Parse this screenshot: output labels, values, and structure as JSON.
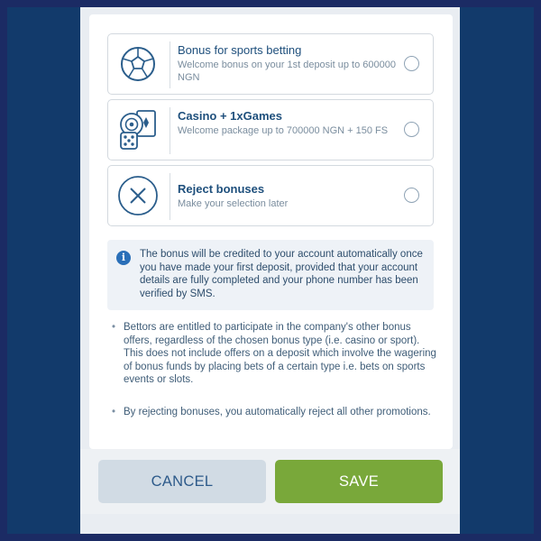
{
  "options": [
    {
      "title": "Bonus for sports betting",
      "desc": "Welcome bonus on your 1st deposit up to 600000 NGN",
      "icon": "soccer-ball-icon",
      "selected": false
    },
    {
      "title": "Casino + 1xGames",
      "desc": "Welcome package up to 700000 NGN + 150 FS",
      "icon": "casino-chips-cards-icon",
      "selected": false
    },
    {
      "title": "Reject bonuses",
      "desc": "Make your selection later",
      "icon": "close-circle-icon",
      "selected": false
    }
  ],
  "info": {
    "icon": "info-icon",
    "glyph": "i",
    "text": "The bonus will be credited to your account automatically once you have made your first deposit, provided that your account details are fully completed and your phone number has been verified by SMS."
  },
  "bullets": [
    "Bettors are entitled to participate in the company's other bonus offers, regardless of the chosen bonus type (i.e. casino or sport). This does not include offers on a deposit which involve the wagering of bonus funds by placing bets of a certain type i.e. bets on sports events or slots.",
    "By rejecting bonuses, you automatically reject all other promotions."
  ],
  "buttons": {
    "cancel": "CANCEL",
    "save": "SAVE"
  },
  "colors": {
    "outer_border": "#1b2b64",
    "background": "#123a6b",
    "accent_green": "#79a83a",
    "text_blue": "#1e4f7c"
  }
}
